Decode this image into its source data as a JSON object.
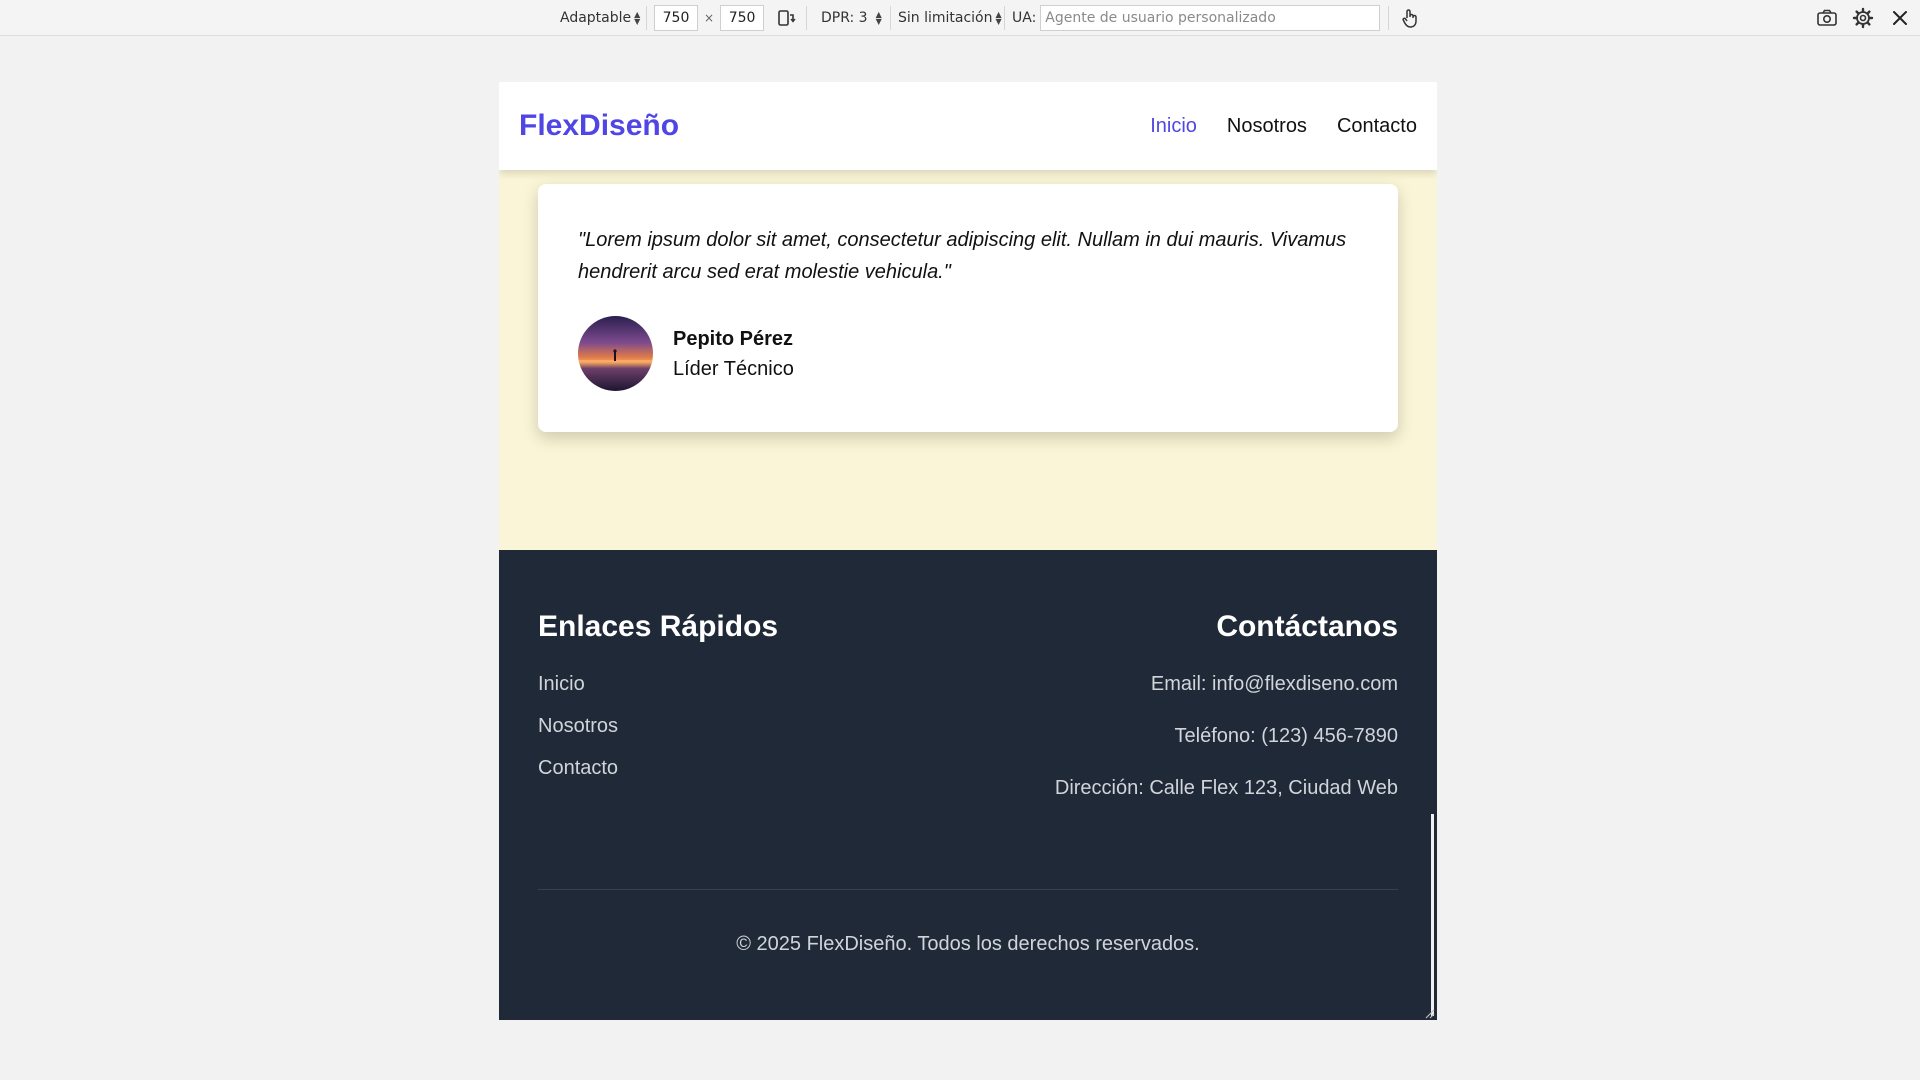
{
  "devtools": {
    "device_mode": "Adaptable",
    "width": "750",
    "height": "750",
    "times": "×",
    "dpr": "DPR: 3",
    "throttling": "Sin limitación",
    "ua_label": "UA:",
    "ua_placeholder": "Agente de usuario personalizado",
    "icons": [
      "rotate-icon",
      "touch-icon",
      "screenshot-icon",
      "settings-icon",
      "close-icon"
    ]
  },
  "site": {
    "logo": "FlexDiseño",
    "nav": [
      {
        "label": "Inicio",
        "active": true
      },
      {
        "label": "Nosotros",
        "active": false
      },
      {
        "label": "Contacto",
        "active": false
      }
    ],
    "colors": {
      "accent": "#4f46e5",
      "hero_bg": "#faf5d6",
      "footer_bg": "#1f2937",
      "footer_text": "#d1d5db"
    },
    "testimonial": {
      "quote": "\"Lorem ipsum dolor sit amet, consectetur adipiscing elit. Nullam in dui mauris. Vivamus hendrerit arcu sed erat molestie vehicula.\"",
      "author_name": "Pepito Pérez",
      "author_role": "Líder Técnico"
    },
    "footer": {
      "quick_links_heading": "Enlaces Rápidos",
      "quick_links": [
        "Inicio",
        "Nosotros",
        "Contacto"
      ],
      "contact_heading": "Contáctanos",
      "contact_lines": [
        "Email: info@flexdiseno.com",
        "Teléfono: (123) 456-7890",
        "Dirección: Calle Flex 123, Ciudad Web"
      ],
      "copyright": "© 2025 FlexDiseño. Todos los derechos reservados."
    }
  }
}
